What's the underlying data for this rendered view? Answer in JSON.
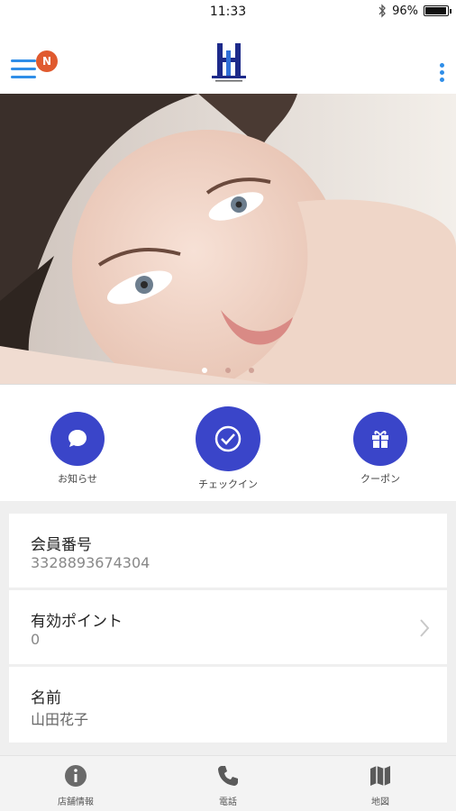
{
  "status_bar": {
    "time": "11:33",
    "battery": "96%",
    "battery_level": 0.96
  },
  "header": {
    "notification_badge": "N"
  },
  "hero": {
    "slide_count": 3,
    "active_slide": 1
  },
  "quick_actions": [
    {
      "label": "お知らせ",
      "icon": "chat-bubble-icon"
    },
    {
      "label": "チェックイン",
      "icon": "check-circle-icon"
    },
    {
      "label": "クーポン",
      "icon": "gift-icon"
    }
  ],
  "member": {
    "number_label": "会員番号",
    "number_value": "3328893674304",
    "points_label": "有効ポイント",
    "points_value": "0",
    "name_label": "名前",
    "name_value": "山田花子"
  },
  "bottom_nav": [
    {
      "label": "店舗情報",
      "icon": "info-icon"
    },
    {
      "label": "電話",
      "icon": "phone-icon"
    },
    {
      "label": "地図",
      "icon": "map-icon"
    }
  ],
  "colors": {
    "accent": "#3a45c9",
    "menu_blue": "#2f8ee8",
    "badge": "#e05a2f"
  }
}
